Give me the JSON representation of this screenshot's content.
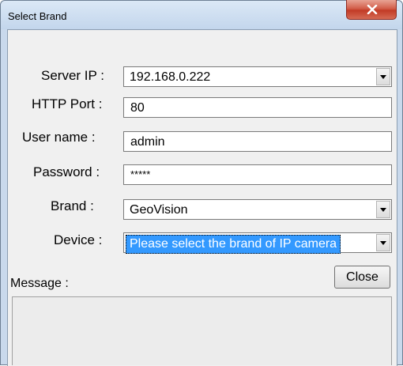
{
  "window": {
    "title": "Select Brand"
  },
  "form": {
    "server_ip": {
      "label": "Server IP :",
      "value": "192.168.0.222"
    },
    "http_port": {
      "label": "HTTP Port :",
      "value": "80"
    },
    "user_name": {
      "label": "User name :",
      "value": "admin"
    },
    "password": {
      "label": "Password :",
      "value": "*****"
    },
    "brand": {
      "label": "Brand :",
      "value": "GeoVision"
    },
    "device": {
      "label": "Device :",
      "value": "Please select the brand of IP camera"
    }
  },
  "buttons": {
    "close_label": "Close"
  },
  "message": {
    "label": "Message :",
    "value": ""
  },
  "icons": {
    "close": "close-icon",
    "dropdown": "chevron-down-icon"
  },
  "colors": {
    "selection": "#3399ff",
    "close_button": "#c9452f"
  }
}
